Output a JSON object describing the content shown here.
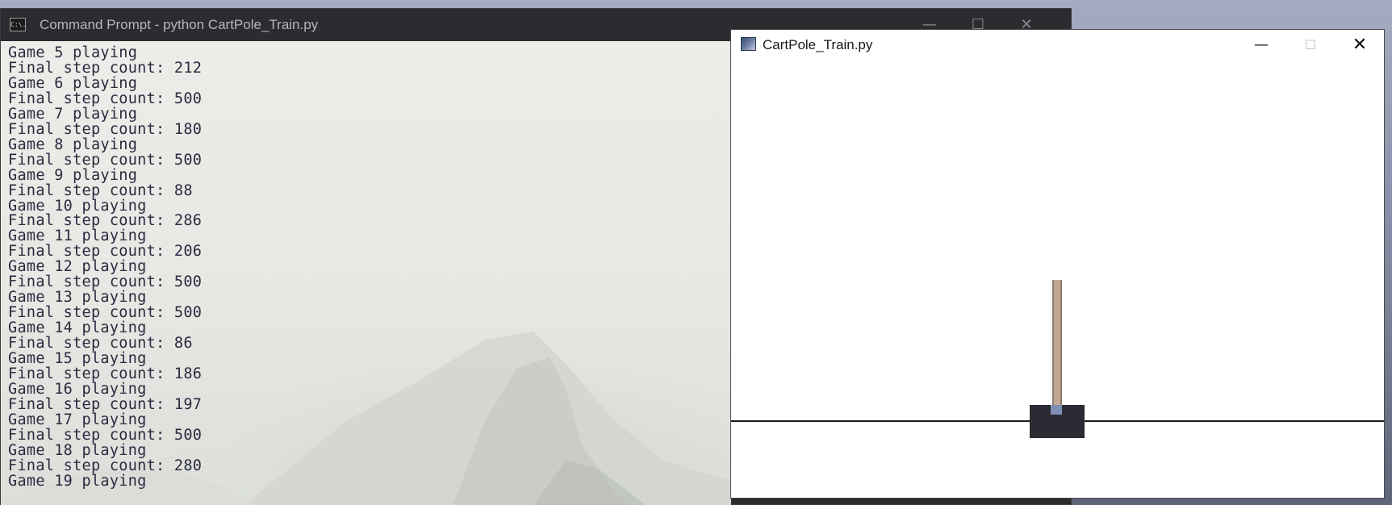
{
  "cmd_window": {
    "title": "Command Prompt - python  CartPole_Train.py",
    "icon_label": "C:\\.",
    "minimize_glyph": "—",
    "maximize_glyph": "☐",
    "close_glyph": "✕",
    "console_lines": [
      "Game 5 playing",
      "Final step count: 212",
      "Game 6 playing",
      "Final step count: 500",
      "Game 7 playing",
      "Final step count: 180",
      "Game 8 playing",
      "Final step count: 500",
      "Game 9 playing",
      "Final step count: 88",
      "Game 10 playing",
      "Final step count: 286",
      "Game 11 playing",
      "Final step count: 206",
      "Game 12 playing",
      "Final step count: 500",
      "Game 13 playing",
      "Final step count: 500",
      "Game 14 playing",
      "Final step count: 86",
      "Game 15 playing",
      "Final step count: 186",
      "Game 16 playing",
      "Final step count: 197",
      "Game 17 playing",
      "Final step count: 500",
      "Game 18 playing",
      "Final step count: 280",
      "Game 19 playing"
    ]
  },
  "cartpole_window": {
    "title": "CartPole_Train.py",
    "minimize_glyph": "—",
    "maximize_glyph": "☐",
    "close_glyph": "✕",
    "colors": {
      "cart": "#2b2b33",
      "pole": "#c0a894",
      "axle": "#7f8fb5",
      "track": "#1a1a1a"
    }
  }
}
